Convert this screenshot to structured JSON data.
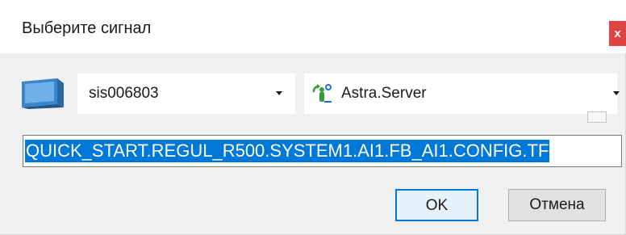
{
  "dialog": {
    "title": "Выберите сигнал",
    "close_label": "x"
  },
  "host": {
    "icon": "computer-icon",
    "selected": "sis006803"
  },
  "server": {
    "icon": "opc-server-icon",
    "selected": "Astra.Server"
  },
  "tag": {
    "value": "QUICK_START.REGUL_R500.SYSTEM1.AI1.FB_AI1.CONFIG.TF"
  },
  "buttons": {
    "ok_label": "OK",
    "cancel_label": "Отмена"
  },
  "colors": {
    "accent": "#0078d7",
    "close": "#e04343",
    "dialog_bg": "#f0f0f0",
    "server_icon_green": "#2e9f3e",
    "server_icon_blue": "#1e6fd9"
  }
}
